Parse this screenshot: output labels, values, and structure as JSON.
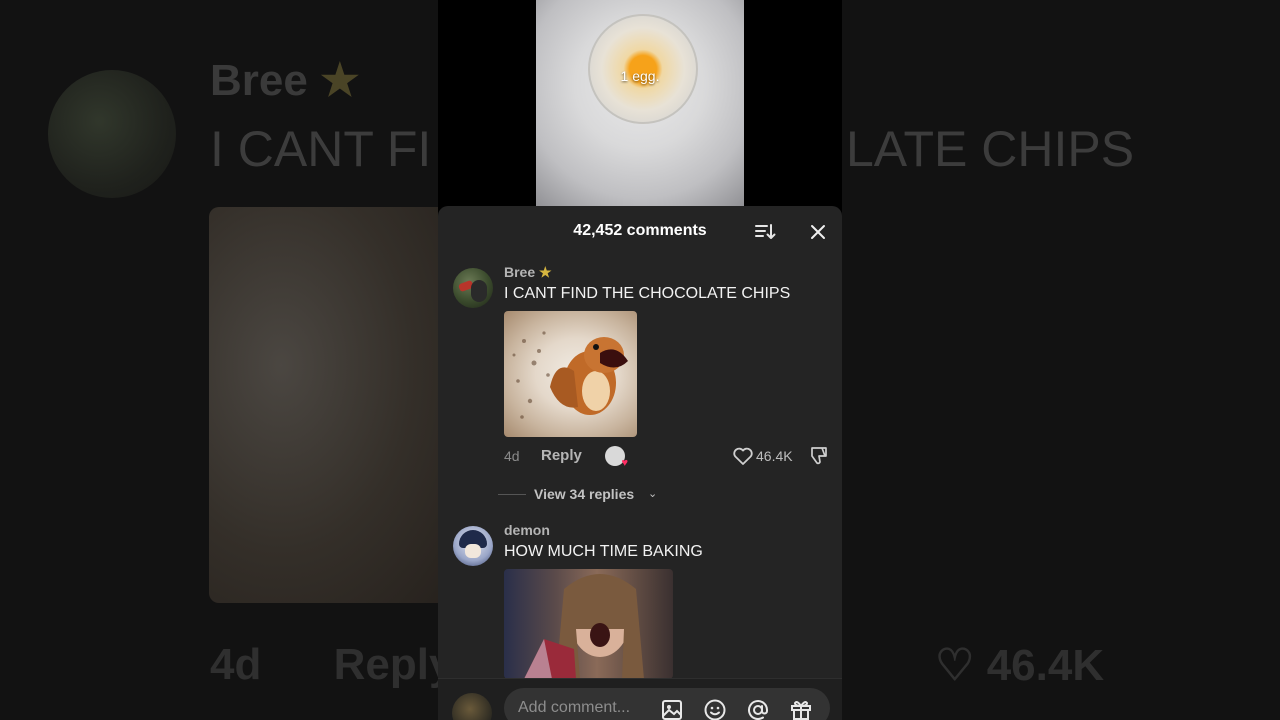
{
  "video": {
    "caption": "1 egg."
  },
  "sheet": {
    "comment_count": "42,452 comments"
  },
  "comments": [
    {
      "username": "Bree",
      "star": "★",
      "text": "I CANT FIND THE CHOCOLATE CHIPS",
      "time": "4d",
      "reply_label": "Reply",
      "likes": "46.4K"
    },
    {
      "username": "demon",
      "text": "HOW MUCH TIME BAKING"
    }
  ],
  "view_replies": {
    "label": "View 34 replies",
    "chevron": "⌄"
  },
  "composer": {
    "placeholder": "Add comment..."
  },
  "background": {
    "name": "Bree",
    "star": "★",
    "text_left": "I CANT FI",
    "text_right": "LATE CHIPS",
    "time": "4d",
    "reply": "Reply",
    "likes": "46.4K"
  }
}
